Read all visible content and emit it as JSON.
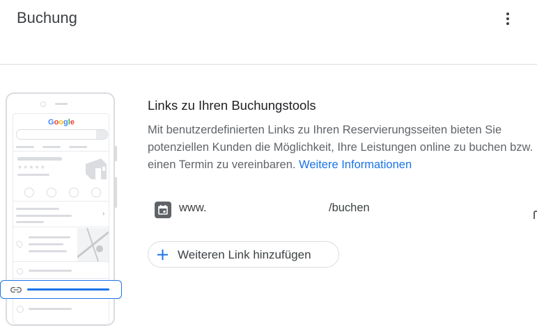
{
  "header": {
    "title": "Buchung"
  },
  "illustration": {
    "logo": "Google",
    "stars": "★★★★★"
  },
  "section": {
    "title": "Links zu Ihren Buchungstools",
    "description": "Mit benutzerdefinierten Links zu Ihren Reservierungsseiten bieten Sie potenziellen Kunden die Möglichkeit, Ihre Leistungen online zu buchen bzw. einen Termin zu vereinbaren.",
    "more_link": "Weitere Informationen"
  },
  "booking_link": {
    "prefix": "www.",
    "suffix": "/buchen",
    "icon": "calendar-icon"
  },
  "add_button": {
    "label": "Weiteren Link hinzufügen",
    "icon": "plus-icon"
  },
  "colors": {
    "accent": "#1a73e8",
    "text": "#202124",
    "secondary": "#5f6368",
    "divider": "#dadce0"
  }
}
